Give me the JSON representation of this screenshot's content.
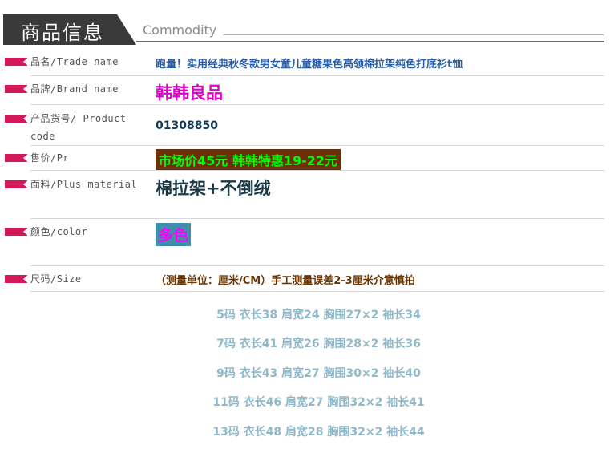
{
  "header": {
    "title": "商品信息",
    "subtitle": "Commodity"
  },
  "rows": [
    {
      "label": "品名/Trade name",
      "value": "跑量！实用经典秋冬款男女童儿童糖果色高领棉拉架纯色打底衫t恤"
    },
    {
      "label": "品牌/Brand name",
      "value": "韩韩良品"
    },
    {
      "label_line1": "产品货号/ Product",
      "label_line2": "code",
      "value": "01308850"
    },
    {
      "label": "售价/Pr",
      "value": "市场价45元 韩韩特惠19-22元"
    },
    {
      "label": "面料/Plus material",
      "value": "棉拉架+不倒绒"
    },
    {
      "label": "颜色/color",
      "value": "多色"
    },
    {
      "label": "尺码/Size",
      "value": "（测量单位：厘米/CM）手工测量误差2-3厘米介意慎拍"
    }
  ],
  "sizes": [
    "5码 衣长38 肩宽24 胸围27×2 袖长34",
    "7码 衣长41 肩宽26 胸围28×2 袖长36",
    "9码 衣长43 肩宽27 胸围30×2 袖长40",
    "11码 衣长46 肩宽27 胸围32×2 袖长41",
    "13码 衣长48 肩宽28 胸围32×2 袖长44"
  ],
  "colors": {
    "marker": "#d2185a",
    "trade_name": "#2a5fa8",
    "brand": "#e000c8",
    "price_bg": "#6b2f0a",
    "price_text": "#00ff00",
    "color_bg": "#3f8fa8",
    "color_text": "#ff00ff",
    "size_list": "#8fb8c8"
  }
}
